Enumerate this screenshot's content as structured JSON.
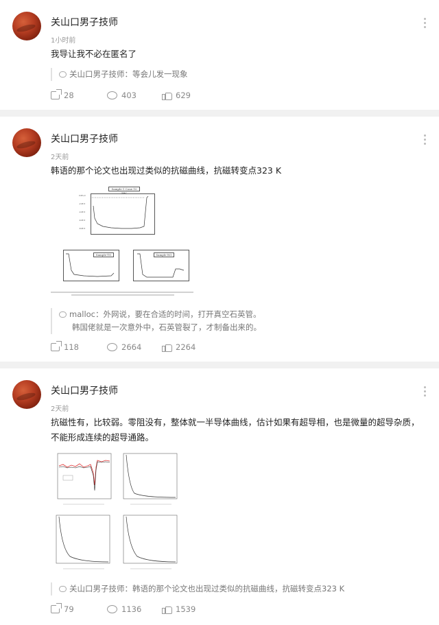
{
  "posts": [
    {
      "author": "关山口男子技师",
      "time": "1小时前",
      "content": "我导让我不必在匿名了",
      "quote": {
        "author": "关山口男子技师：",
        "text": "等会儿发一现象",
        "line2": ""
      },
      "shares": "28",
      "comments": "403",
      "likes": "629"
    },
    {
      "author": "关山口男子技师",
      "time": "2天前",
      "content": "韩语的那个论文也出现过类似的抗磁曲线，抗磁转变点323 K",
      "figure": {
        "main_title": "Sample-1 Cone 10 ZFC",
        "left_title": "Sample-TO",
        "right_title": "Sample-NO"
      },
      "quote": {
        "author": "malloc：",
        "text": "外网说，要在合适的时间，打开真空石英管。",
        "line2": "韩国佬就是一次意外中，石英管裂了，才制备出来的。"
      },
      "shares": "118",
      "comments": "2664",
      "likes": "2264"
    },
    {
      "author": "关山口男子技师",
      "time": "2天前",
      "content": "抗磁性有，比较弱。零阻没有，整体就一半导体曲线，估计如果有超导相，也是微量的超导杂质，不能形成连续的超导通路。",
      "quote": {
        "author": "关山口男子技师：",
        "text": "韩语的那个论文也出现过类似的抗磁曲线，抗磁转变点323 K",
        "line2": ""
      },
      "shares": "79",
      "comments": "1136",
      "likes": "1539"
    }
  ]
}
